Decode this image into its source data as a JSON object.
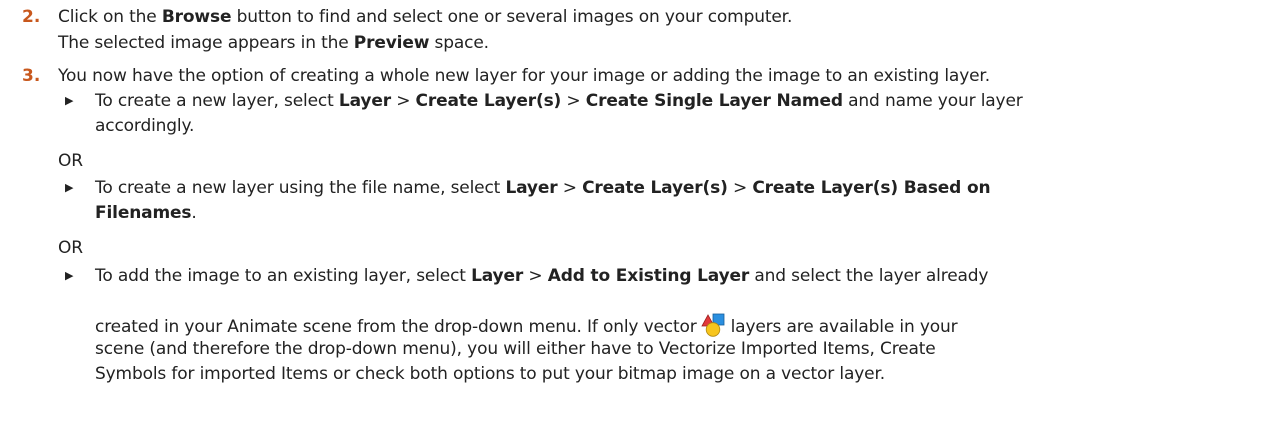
{
  "steps": [
    {
      "number": "2.",
      "line1": {
        "pre": "Click on the ",
        "bold1": "Browse",
        "post": " button to find and select one or several images on your computer."
      },
      "line2": {
        "pre": "The selected image appears in the ",
        "bold1": "Preview",
        "post": " space."
      }
    },
    {
      "number": "3.",
      "intro": "You now have the option of creating a whole new layer for your image or adding the image to an existing layer.",
      "options": [
        {
          "line1": {
            "pre": "To create a new layer, select ",
            "b1": "Layer",
            "sep1": " > ",
            "b2": "Create Layer(s)",
            "sep2": " > ",
            "b3": "Create Single Layer Named",
            "post": " and name your layer"
          },
          "line2": "accordingly."
        },
        {
          "line1": {
            "pre": "To create a new layer using the file name, select ",
            "b1": "Layer",
            "sep1": " > ",
            "b2": "Create Layer(s)",
            "sep2": " > ",
            "b3": "Create Layer(s) Based on"
          },
          "line2": {
            "b": "Filenames",
            "post": "."
          }
        },
        {
          "line1": {
            "pre": "To add the image to an existing layer, select ",
            "b1": "Layer",
            "sep1": " > ",
            "b2": "Add to Existing Layer",
            "post": " and select the layer already"
          },
          "line2": {
            "pre": "created in your Animate scene from the drop-down menu. If only vector",
            "post": "layers are available in your"
          },
          "line3": "scene (and therefore the drop-down menu), you will either have to Vectorize Imported Items, Create",
          "line4": "Symbols for imported Items or check both options to put your bitmap image on a vector layer."
        }
      ],
      "or_label": "OR"
    }
  ],
  "icons": {
    "vector_layer": "vector-layer-icon"
  },
  "colors": {
    "step_number": "#c8581d",
    "text": "#222222"
  }
}
